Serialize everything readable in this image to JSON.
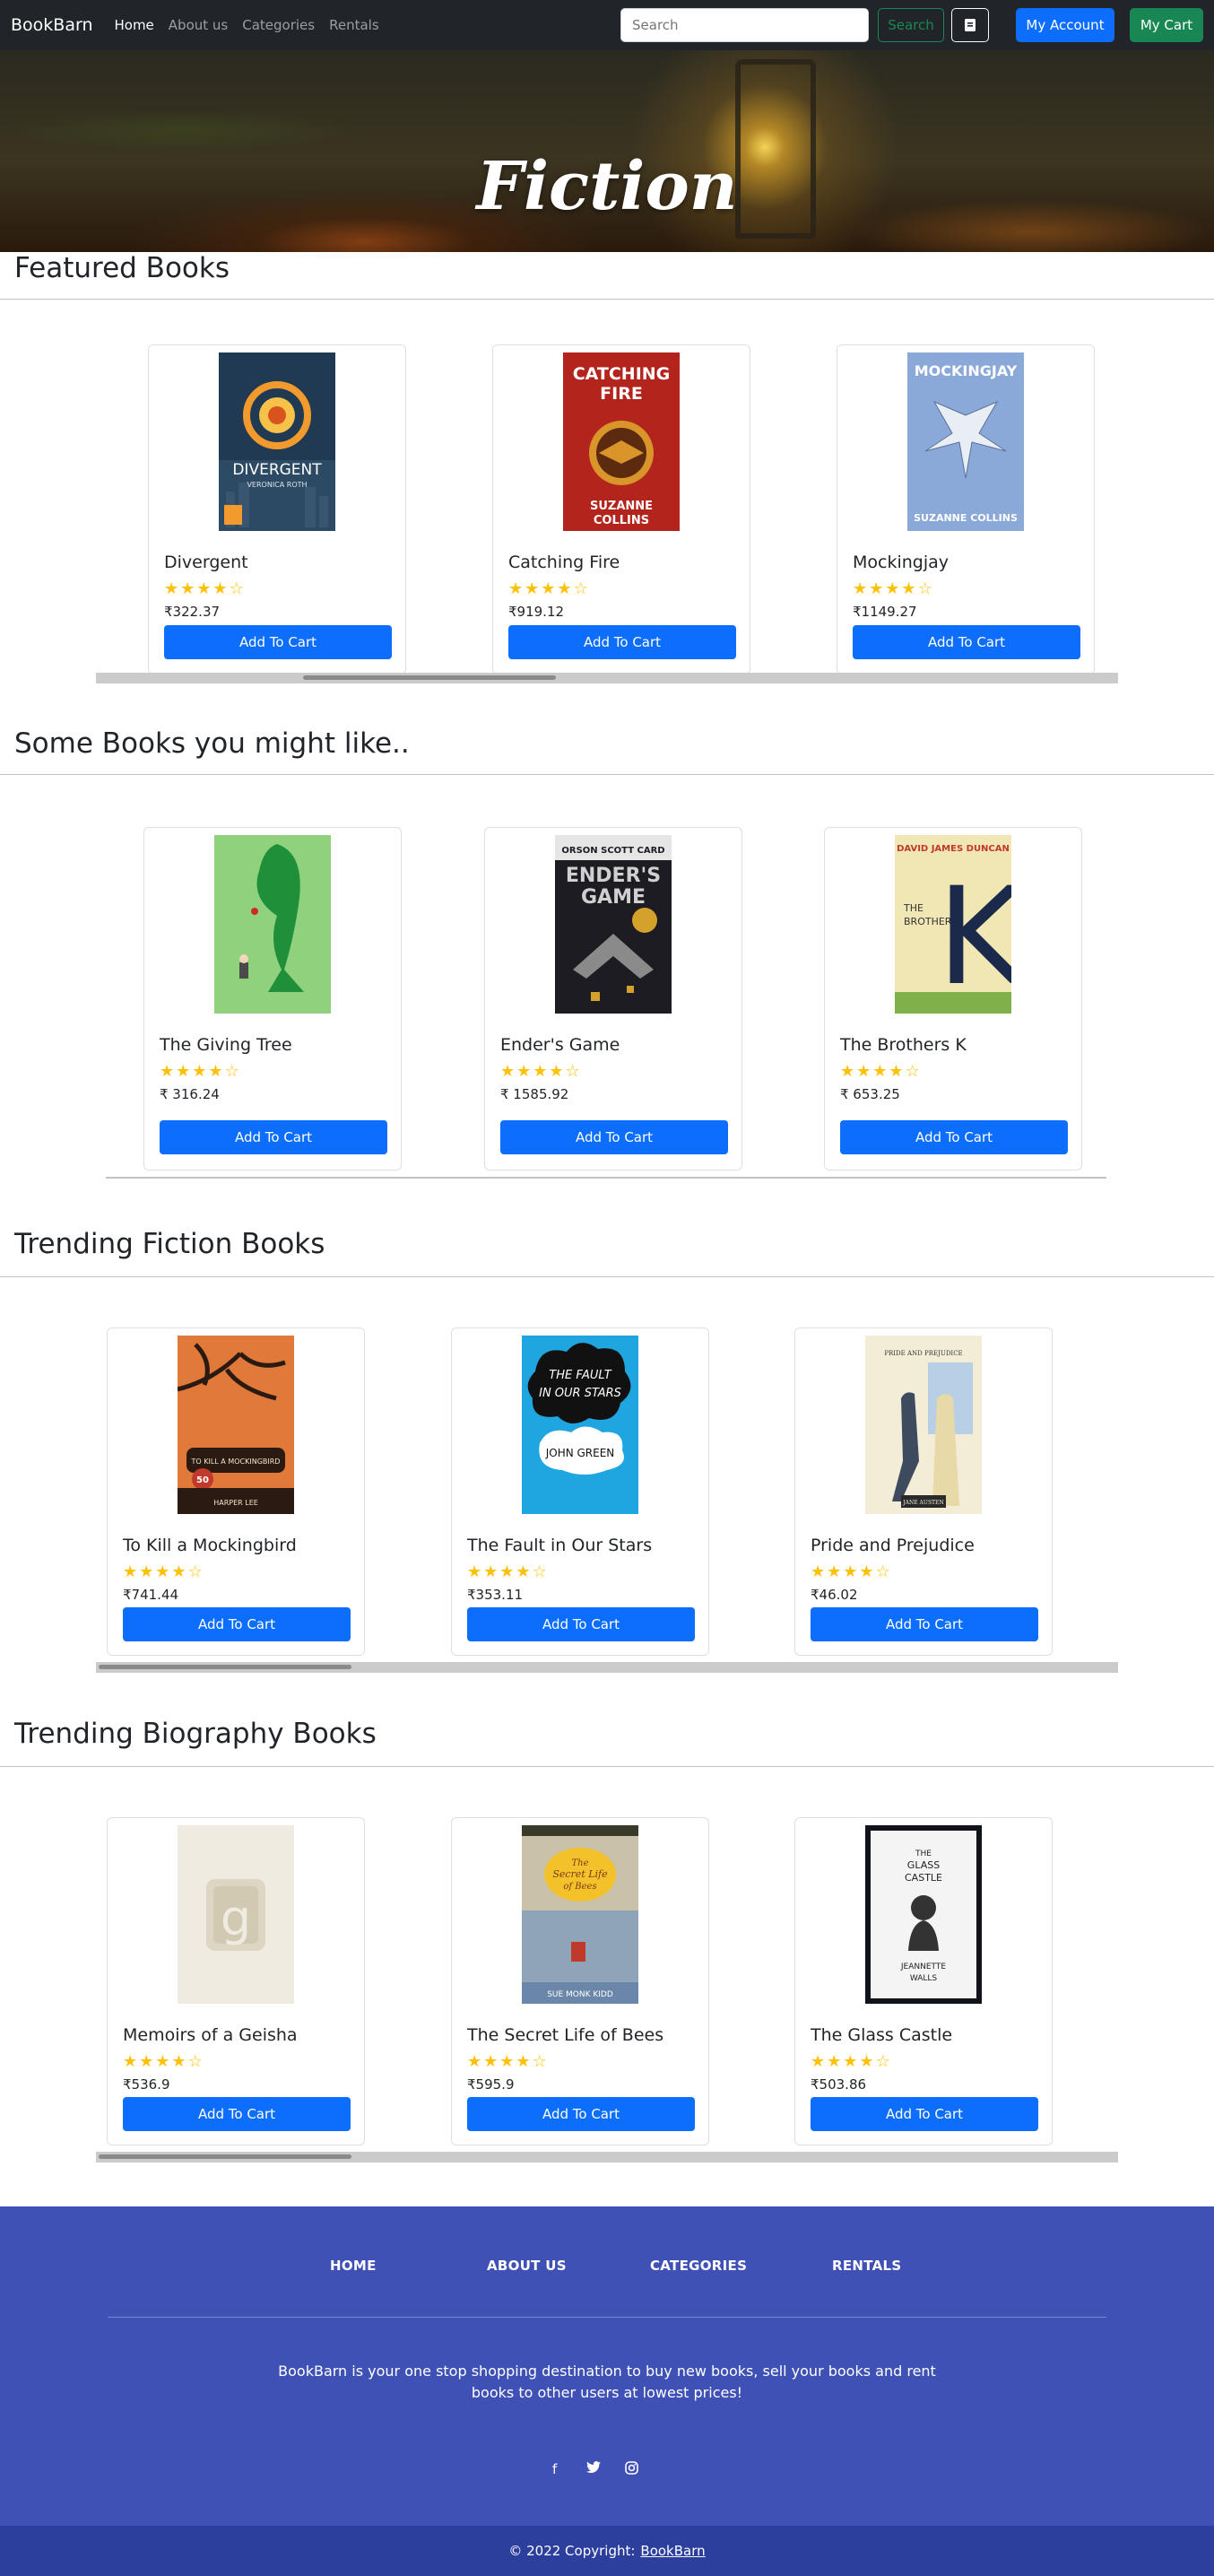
{
  "nav": {
    "brand": "BookBarn",
    "links": [
      "Home",
      "About us",
      "Categories",
      "Rentals"
    ],
    "search_placeholder": "Search",
    "search_label": "Search",
    "account_label": "My Account",
    "cart_label": "My Cart"
  },
  "hero": {
    "title": "Fiction",
    "slide_count": 3,
    "active_slide": 3
  },
  "sections": [
    {
      "title": "Featured Books",
      "books": [
        {
          "title": "Divergent",
          "rating": 4,
          "price": "₹322.37",
          "button": "Add To Cart"
        },
        {
          "title": "Catching Fire",
          "rating": 4,
          "price": "₹919.12",
          "button": "Add To Cart"
        },
        {
          "title": "Mockingjay",
          "rating": 4,
          "price": "₹1149.27",
          "button": "Add To Cart"
        }
      ]
    },
    {
      "title": "Some Books you might like..",
      "books": [
        {
          "title": "The Giving Tree",
          "rating": 4,
          "price": "₹ 316.24",
          "button": "Add To Cart"
        },
        {
          "title": "Ender's Game",
          "rating": 4,
          "price": "₹ 1585.92",
          "button": "Add To Cart"
        },
        {
          "title": "The Brothers K",
          "rating": 4,
          "price": "₹ 653.25",
          "button": "Add To Cart"
        }
      ]
    },
    {
      "title": "Trending Fiction Books",
      "books": [
        {
          "title": "To Kill a Mockingbird",
          "rating": 4,
          "price": "₹741.44",
          "button": "Add To Cart"
        },
        {
          "title": "The Fault in Our Stars",
          "rating": 4,
          "price": "₹353.11",
          "button": "Add To Cart"
        },
        {
          "title": "Pride and Prejudice",
          "rating": 4,
          "price": "₹46.02",
          "button": "Add To Cart"
        }
      ]
    },
    {
      "title": "Trending Biography Books",
      "books": [
        {
          "title": "Memoirs of a Geisha",
          "rating": 4,
          "price": "₹536.9",
          "button": "Add To Cart"
        },
        {
          "title": "The Secret Life of Bees",
          "rating": 4,
          "price": "₹595.9",
          "button": "Add To Cart"
        },
        {
          "title": "The Glass Castle",
          "rating": 4,
          "price": "₹503.86",
          "button": "Add To Cart"
        }
      ]
    }
  ],
  "covers": {
    "divergent": {
      "author": "VERONICA ROTH",
      "title": "DIVERGENT"
    },
    "catching_fire": {
      "title_1": "CATCHING",
      "title_2": "FIRE",
      "author_1": "SUZANNE",
      "author_2": "COLLINS"
    },
    "mockingjay": {
      "title": "MOCKINGJAY",
      "author": "SUZANNE COLLINS"
    },
    "enders_game": {
      "author": "ORSON SCOTT CARD",
      "title_1": "ENDER'S",
      "title_2": "GAME"
    },
    "brothers_k": {
      "author": "DAVID JAMES DUNCAN",
      "title_1": "THE",
      "title_2": "BROTHERS",
      "letter": "K"
    },
    "mockingbird": {
      "title": "TO KILL A MOCKINGBIRD",
      "badge": "50",
      "author": "HARPER LEE"
    },
    "fault_stars": {
      "title_1": "THE FAULT",
      "title_2": "IN OUR STARS",
      "author": "JOHN GREEN"
    },
    "pride": {
      "title": "PRIDE AND PREJUDICE",
      "author": "JANE AUSTEN"
    },
    "geisha": {
      "letter": "g"
    },
    "bees": {
      "title_1": "The",
      "title_2": "Secret Life",
      "title_3": "of Bees",
      "author": "SUE MONK KIDD"
    },
    "glass_castle": {
      "title_1": "THE",
      "title_2": "GLASS",
      "title_3": "CASTLE",
      "author_1": "JEANNETTE",
      "author_2": "WALLS"
    }
  },
  "footer": {
    "links": [
      "HOME",
      "ABOUT US",
      "CATEGORIES",
      "RENTALS"
    ],
    "description": "BookBarn is your one stop shopping destination to buy new books, sell your books and rent books to other users at lowest prices!",
    "socials": [
      "facebook-icon",
      "twitter-icon",
      "instagram-icon"
    ],
    "copyright": "© 2022 Copyright:",
    "copyright_link": "BookBarn"
  },
  "colors": {
    "primary": "#0d6efd",
    "success": "#198754",
    "navbar": "#212529",
    "footer": "#3f51b5",
    "footer_bottom": "#2d3f9c",
    "star": "#ffc107"
  }
}
